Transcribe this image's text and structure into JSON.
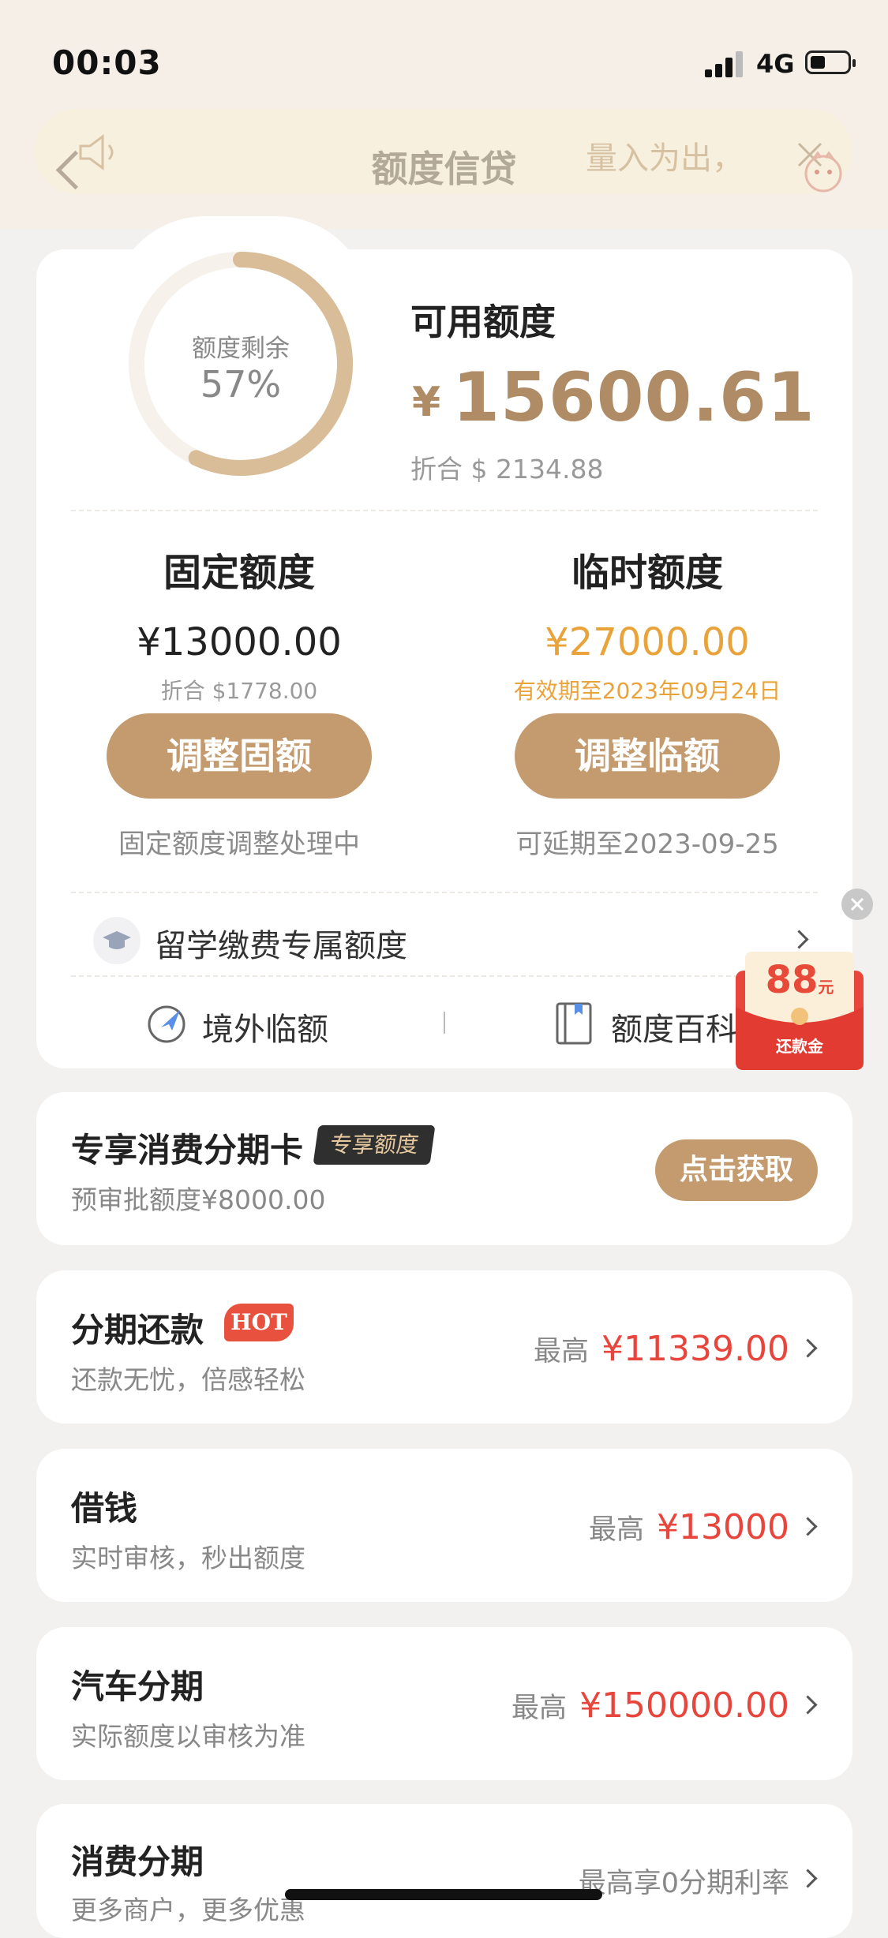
{
  "status_bar": {
    "time": "00:03",
    "network": "4G"
  },
  "nav": {
    "title": "额度信贷",
    "marquee": "量入为出，"
  },
  "summary": {
    "ring_label": "额度剩余",
    "ring_percent_text": "57%",
    "remaining_fraction": 0.57,
    "available_title": "可用额度",
    "currency": "¥",
    "available_amount": "15600.61",
    "converted": "折合 $ 2134.88"
  },
  "fixed": {
    "title": "固定额度",
    "amount": "¥13000.00",
    "converted": "折合 $1778.00",
    "button": "调整固额",
    "note": "固定额度调整处理中"
  },
  "temp": {
    "title": "临时额度",
    "amount": "¥27000.00",
    "validity": "有效期至2023年09月24日",
    "button": "调整临额",
    "note": "可延期至2023-09-25"
  },
  "study": {
    "label": "留学缴费专属额度"
  },
  "tools": {
    "overseas": "境外临额",
    "wiki": "额度百科"
  },
  "red_packet": {
    "amount": "88",
    "unit": "元",
    "label": "还款金"
  },
  "offers": {
    "card": {
      "title": "专享消费分期卡",
      "tag": "专享额度",
      "sub": "预审批额度¥8000.00",
      "button": "点击获取"
    },
    "installment": {
      "title": "分期还款",
      "tag": "HOT",
      "sub": "还款无忧，倍感轻松",
      "max_label": "最高",
      "max_value": "¥11339.00"
    },
    "borrow": {
      "title": "借钱",
      "sub": "实时审核，秒出额度",
      "max_label": "最高",
      "max_value": "¥13000"
    },
    "car": {
      "title": "汽车分期",
      "sub": "实际额度以审核为准",
      "max_label": "最高",
      "max_value": "¥150000.00"
    },
    "consume": {
      "title": "消费分期",
      "sub": "更多商户，更多优惠",
      "max_text": "最高享0分期利率"
    }
  },
  "colors": {
    "accent": "#c49b6f",
    "amount_gold": "#b08c66",
    "orange": "#e9a33b",
    "red": "#e8453c"
  }
}
